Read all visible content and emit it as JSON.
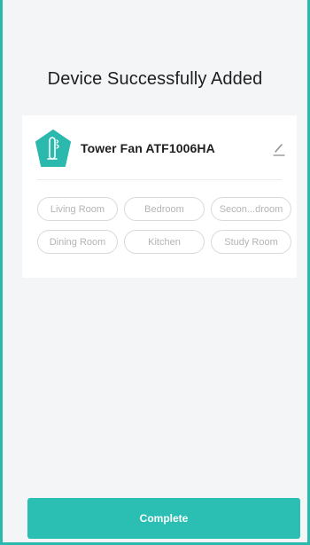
{
  "page": {
    "title": "Device Successfully Added"
  },
  "device": {
    "name": "Tower Fan ATF1006HA",
    "icon": "tower-fan-icon",
    "accent_color": "#2bb8ad"
  },
  "rooms": [
    "Living Room",
    "Bedroom",
    "Secon...droom",
    "Dining Room",
    "Kitchen",
    "Study Room"
  ],
  "actions": {
    "complete_label": "Complete"
  },
  "colors": {
    "accent": "#2bbfb3",
    "background": "#f4f5f6",
    "card": "#ffffff",
    "chip_text": "#b4b4b4",
    "chip_border": "#d9d9d9"
  }
}
